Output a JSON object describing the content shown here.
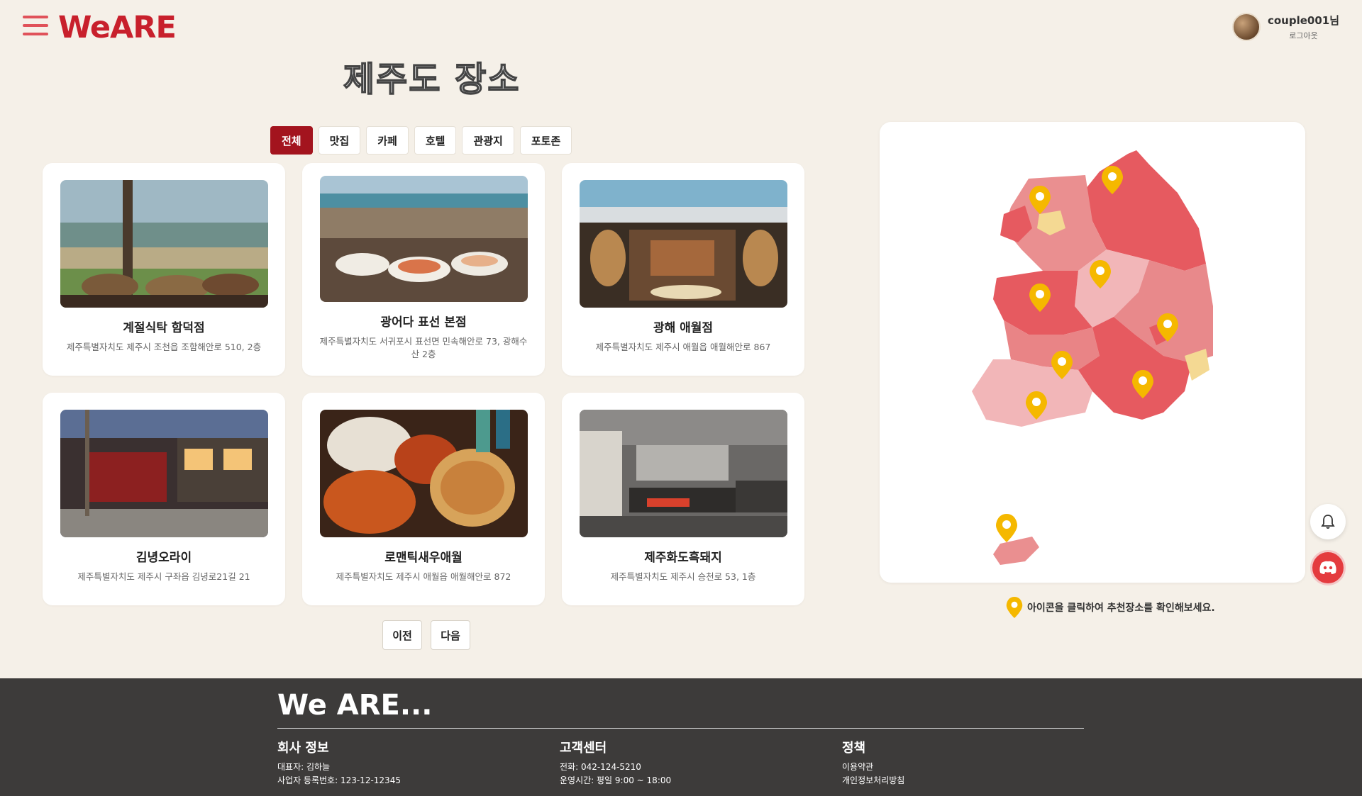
{
  "header": {
    "logo": "WeARE",
    "user_name": "couple001님",
    "logout_label": "로그아웃"
  },
  "page_title": "제주도 장소",
  "tabs": [
    {
      "label": "전체",
      "active": true
    },
    {
      "label": "맛집",
      "active": false
    },
    {
      "label": "카페",
      "active": false
    },
    {
      "label": "호텔",
      "active": false
    },
    {
      "label": "관광지",
      "active": false
    },
    {
      "label": "포토존",
      "active": false
    }
  ],
  "places": [
    {
      "name": "계절식탁 함덕점",
      "address": "제주특별자치도 제주시 조천읍 조함해안로 510, 2층"
    },
    {
      "name": "광어다 표선 본점",
      "address": "제주특별자치도 서귀포시 표선면 민속해안로 73, 광해수산 2층"
    },
    {
      "name": "광해 애월점",
      "address": "제주특별자치도 제주시 애월읍 애월해안로 867"
    },
    {
      "name": "김녕오라이",
      "address": "제주특별자치도 제주시 구좌읍 김녕로21길 21"
    },
    {
      "name": "로맨틱새우애월",
      "address": "제주특별자치도 제주시 애월읍 애월해안로 872"
    },
    {
      "name": "제주화도흑돼지",
      "address": "제주특별자치도 제주시 승천로 53, 1층"
    }
  ],
  "pagination": {
    "prev_label": "이전",
    "next_label": "다음"
  },
  "map": {
    "hint": "아이콘을 클릭하여 추천장소를 확인해보세요.",
    "pin_color": "#f5b800"
  },
  "footer": {
    "title": "We ARE...",
    "company": {
      "heading": "회사 정보",
      "ceo": "대표자: 김하늘",
      "biz_no": "사업자 등록번호: 123-12-12345"
    },
    "support": {
      "heading": "고객센터",
      "phone": "전화: 042-124-5210",
      "hours": "운영시간: 평일 9:00 ~ 18:00"
    },
    "policy": {
      "heading": "정책",
      "terms": "이용약관",
      "privacy": "개인정보처리방침"
    }
  },
  "colors": {
    "brand": "#c8202c",
    "tab_active": "#a3141e",
    "footer_bg": "#3d3b3a",
    "background": "#f5f0e8"
  },
  "icons": [
    "hamburger-menu-icon",
    "bell-icon",
    "discord-icon",
    "map-pin-icon"
  ]
}
